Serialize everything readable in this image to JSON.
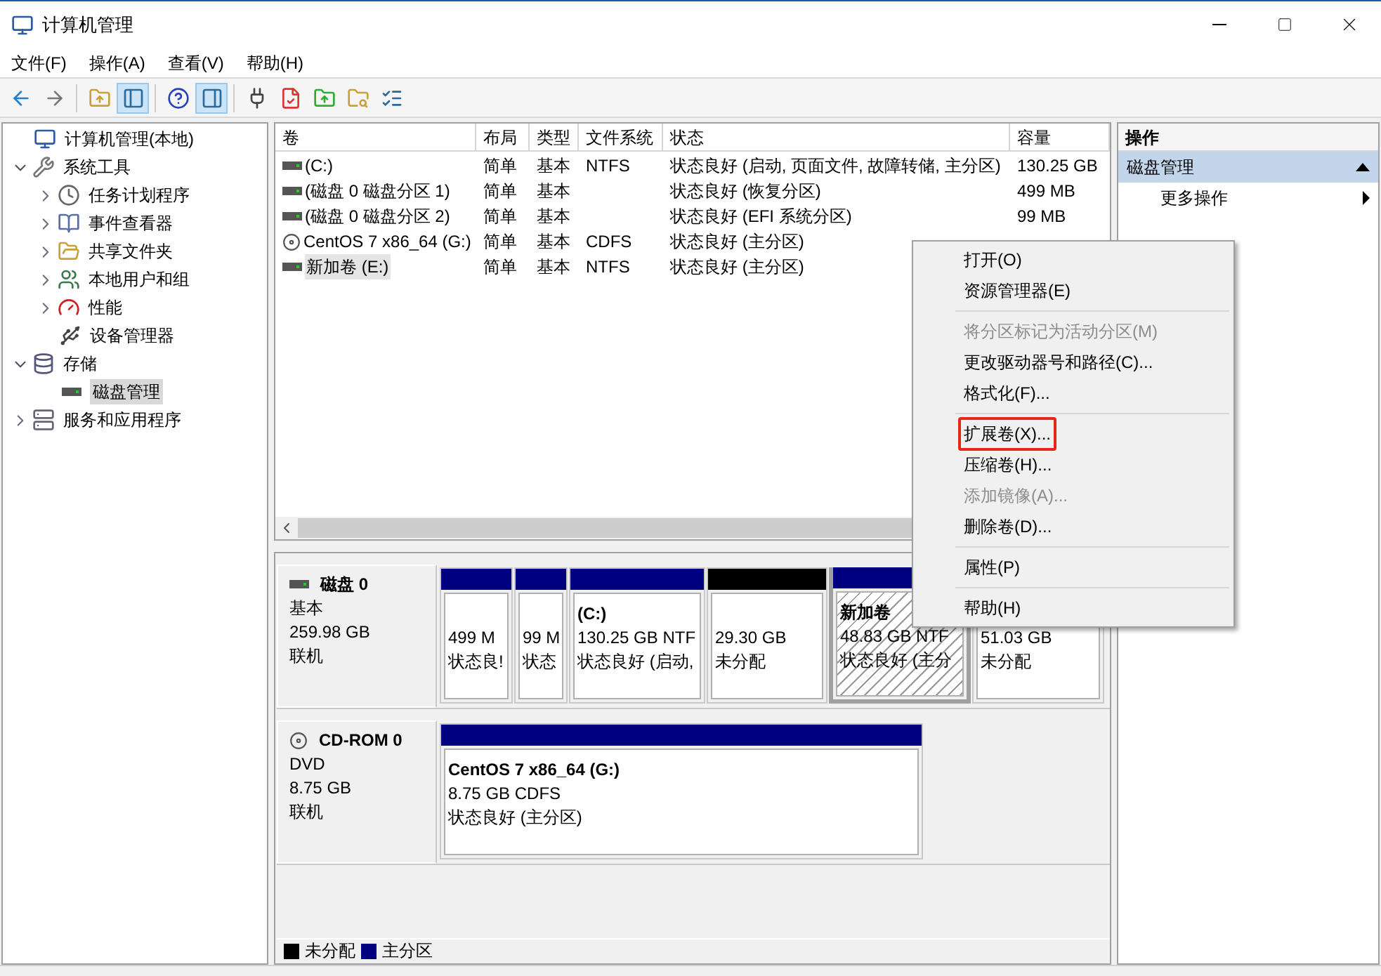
{
  "window": {
    "title": "计算机管理"
  },
  "menu_bar": [
    "文件(F)",
    "操作(A)",
    "查看(V)",
    "帮助(H)"
  ],
  "toolbar": [
    {
      "pressed": false
    },
    {
      "pressed": false
    },
    {
      "pressed": false
    },
    {
      "pressed": true
    },
    {
      "pressed": false
    },
    {
      "pressed": true
    },
    {
      "pressed": false
    },
    {
      "pressed": false
    },
    {
      "pressed": false
    },
    {
      "pressed": false
    },
    {
      "pressed": false
    }
  ],
  "tree": [
    {
      "label": "计算机管理(本地)",
      "selected": false,
      "children": [
        {
          "label": "系统工具",
          "selected": false,
          "expanded": true,
          "children": [
            {
              "label": "任务计划程序",
              "selected": false,
              "expanded": false
            },
            {
              "label": "事件查看器",
              "selected": false,
              "expanded": false
            },
            {
              "label": "共享文件夹",
              "selected": false,
              "expanded": false
            },
            {
              "label": "本地用户和组",
              "selected": false,
              "expanded": false
            },
            {
              "label": "性能",
              "selected": false,
              "expanded": false
            },
            {
              "label": "设备管理器",
              "selected": false
            }
          ]
        },
        {
          "label": "存储",
          "selected": false,
          "expanded": true,
          "children": [
            {
              "label": "磁盘管理",
              "selected": true
            }
          ]
        },
        {
          "label": "服务和应用程序",
          "selected": false,
          "expanded": false
        }
      ]
    }
  ],
  "volume_table": {
    "columns": [
      "卷",
      "布局",
      "类型",
      "文件系统",
      "状态",
      "容量"
    ],
    "rows": [
      {
        "kind": "disk",
        "selected": false,
        "cells": [
          "(C:)",
          "简单",
          "基本",
          "NTFS",
          "状态良好 (启动, 页面文件, 故障转储, 主分区)",
          "130.25 GB"
        ]
      },
      {
        "kind": "disk",
        "selected": false,
        "cells": [
          "(磁盘 0 磁盘分区 1)",
          "简单",
          "基本",
          "",
          "状态良好 (恢复分区)",
          "499 MB"
        ]
      },
      {
        "kind": "disk",
        "selected": false,
        "cells": [
          "(磁盘 0 磁盘分区 2)",
          "简单",
          "基本",
          "",
          "状态良好 (EFI 系统分区)",
          "99 MB"
        ]
      },
      {
        "kind": "cdrom",
        "selected": false,
        "cells": [
          "CentOS 7 x86_64 (G:)",
          "简单",
          "基本",
          "CDFS",
          "状态良好 (主分区)"
        ]
      },
      {
        "kind": "disk",
        "selected": true,
        "cells": [
          "新加卷 (E:)",
          "简单",
          "基本",
          "NTFS",
          "状态良好 (主分区)"
        ]
      }
    ]
  },
  "disks": [
    {
      "kind": "disk",
      "name": "磁盘 0",
      "type": "基本",
      "size": "259.98 GB",
      "status": "联机",
      "partitions": [
        {
          "color": "#000080",
          "selected": false,
          "size": "499 M",
          "status": "状态良!"
        },
        {
          "color": "#000080",
          "selected": false,
          "size": "99 M",
          "status": "状态"
        },
        {
          "color": "#000080",
          "selected": false,
          "title": "(C:)",
          "size": "130.25 GB NTF",
          "status": "状态良好 (启动,"
        },
        {
          "color": "#000000",
          "selected": false,
          "size": "29.30 GB",
          "status": "未分配"
        },
        {
          "color": "#000080",
          "selected": true,
          "title": "新加卷",
          "size": "48.83 GB NTF",
          "status": "状态良好 (主分"
        },
        {
          "selected": false,
          "size": "51.03 GB",
          "status": "未分配"
        }
      ]
    },
    {
      "kind": "cdrom",
      "name": "CD-ROM 0",
      "type": "DVD",
      "size": "8.75 GB",
      "status": "联机",
      "partitions": [
        {
          "color": "#000080",
          "selected": false,
          "title": "CentOS 7 x86_64  (G:)",
          "size": "8.75 GB CDFS",
          "status": "状态良好 (主分区)"
        }
      ]
    }
  ],
  "legend": [
    {
      "label": "未分配",
      "color": "#000000"
    },
    {
      "label": "主分区",
      "color": "#000080"
    }
  ],
  "actions": {
    "title": "操作",
    "section": {
      "label": "磁盘管理",
      "expanded": true
    },
    "items": [
      "更多操作"
    ]
  },
  "context_menu": [
    {
      "kind": "item",
      "label": "打开(O)",
      "disabled": false,
      "highlighted": false
    },
    {
      "kind": "item",
      "label": "资源管理器(E)",
      "disabled": false,
      "highlighted": false
    },
    {
      "kind": "separator"
    },
    {
      "kind": "item",
      "label": "将分区标记为活动分区(M)",
      "disabled": true,
      "highlighted": false
    },
    {
      "kind": "item",
      "label": "更改驱动器号和路径(C)...",
      "disabled": false,
      "highlighted": false
    },
    {
      "kind": "item",
      "label": "格式化(F)...",
      "disabled": false,
      "highlighted": false
    },
    {
      "kind": "separator"
    },
    {
      "kind": "item",
      "label": "扩展卷(X)...",
      "disabled": false,
      "highlighted": true
    },
    {
      "kind": "item",
      "label": "压缩卷(H)...",
      "disabled": false,
      "highlighted": false
    },
    {
      "kind": "item",
      "label": "添加镜像(A)...",
      "disabled": true,
      "highlighted": false
    },
    {
      "kind": "item",
      "label": "删除卷(D)...",
      "disabled": false,
      "highlighted": false
    },
    {
      "kind": "separator"
    },
    {
      "kind": "item",
      "label": "属性(P)",
      "disabled": false,
      "highlighted": false
    },
    {
      "kind": "separator"
    },
    {
      "kind": "item",
      "label": "帮助(H)",
      "disabled": false,
      "highlighted": false
    }
  ]
}
